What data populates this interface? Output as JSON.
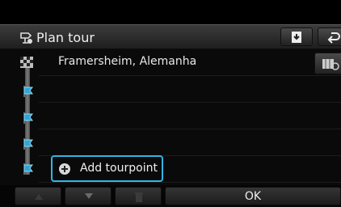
{
  "header": {
    "title": "Plan tour"
  },
  "tour": {
    "destination": "Framersheim, Alemanha",
    "add_label": "Add tourpoint"
  },
  "footer": {
    "ok_label": "OK"
  },
  "colors": {
    "focus_border": "#2fb6e6",
    "waypoint_flag": "#2aa7d6"
  }
}
